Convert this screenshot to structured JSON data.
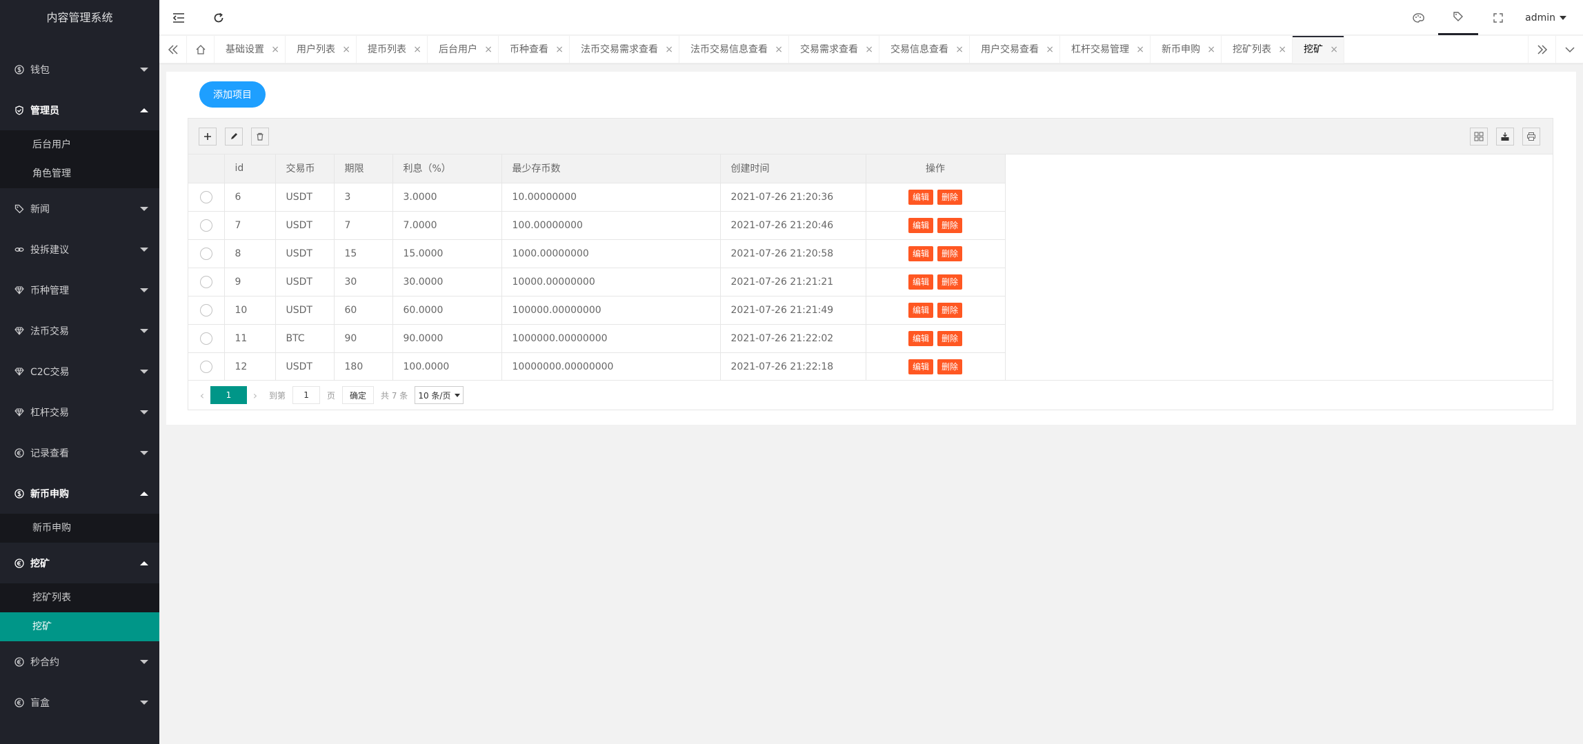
{
  "app": {
    "title": "内容管理系统"
  },
  "sidebar": {
    "groups": [
      {
        "label": "钱包",
        "icon": "dollar-icon",
        "open": false,
        "items": []
      },
      {
        "label": "管理员",
        "icon": "shield-icon",
        "open": true,
        "items": [
          {
            "label": "后台用户",
            "active": false
          },
          {
            "label": "角色管理",
            "active": false
          }
        ]
      },
      {
        "label": "新闻",
        "icon": "tag-icon",
        "open": false,
        "items": []
      },
      {
        "label": "投拆建议",
        "icon": "link-icon",
        "open": false,
        "items": []
      },
      {
        "label": "币种管理",
        "icon": "diamond-icon",
        "open": false,
        "items": []
      },
      {
        "label": "法币交易",
        "icon": "diamond-icon",
        "open": false,
        "items": []
      },
      {
        "label": "C2C交易",
        "icon": "diamond-icon",
        "open": false,
        "items": []
      },
      {
        "label": "杠杆交易",
        "icon": "diamond-icon",
        "open": false,
        "items": []
      },
      {
        "label": "记录查看",
        "icon": "euro-icon",
        "open": false,
        "items": []
      },
      {
        "label": "新币申购",
        "icon": "dollar-icon",
        "open": true,
        "items": [
          {
            "label": "新币申购",
            "active": false
          }
        ]
      },
      {
        "label": "挖矿",
        "icon": "euro-icon",
        "open": true,
        "items": [
          {
            "label": "挖矿列表",
            "active": false
          },
          {
            "label": "挖矿",
            "active": true
          }
        ]
      },
      {
        "label": "秒合约",
        "icon": "euro-icon",
        "open": false,
        "items": []
      },
      {
        "label": "盲盒",
        "icon": "euro-icon",
        "open": false,
        "items": []
      }
    ]
  },
  "header": {
    "user": "admin",
    "icons": [
      "collapse-menu-icon",
      "refresh-icon",
      "theme-icon",
      "tag-icon",
      "fullscreen-icon"
    ]
  },
  "tabs": [
    {
      "label": "基础设置",
      "active": false
    },
    {
      "label": "用户列表",
      "active": false
    },
    {
      "label": "提币列表",
      "active": false
    },
    {
      "label": "后台用户",
      "active": false
    },
    {
      "label": "币种查看",
      "active": false
    },
    {
      "label": "法币交易需求查看",
      "active": false
    },
    {
      "label": "法币交易信息查看",
      "active": false
    },
    {
      "label": "交易需求查看",
      "active": false
    },
    {
      "label": "交易信息查看",
      "active": false
    },
    {
      "label": "用户交易查看",
      "active": false
    },
    {
      "label": "杠杆交易管理",
      "active": false
    },
    {
      "label": "新币申购",
      "active": false
    },
    {
      "label": "挖矿列表",
      "active": false
    },
    {
      "label": "挖矿",
      "active": true
    }
  ],
  "content": {
    "add_button": "添加项目",
    "columns": [
      "id",
      "交易币",
      "期限",
      "利息（%）",
      "最少存币数",
      "创建时间",
      "操作"
    ],
    "rows": [
      {
        "id": "6",
        "coin": "USDT",
        "term": "3",
        "interest": "3.0000",
        "min": "10.00000000",
        "created": "2021-07-26 21:20:36"
      },
      {
        "id": "7",
        "coin": "USDT",
        "term": "7",
        "interest": "7.0000",
        "min": "100.00000000",
        "created": "2021-07-26 21:20:46"
      },
      {
        "id": "8",
        "coin": "USDT",
        "term": "15",
        "interest": "15.0000",
        "min": "1000.00000000",
        "created": "2021-07-26 21:20:58"
      },
      {
        "id": "9",
        "coin": "USDT",
        "term": "30",
        "interest": "30.0000",
        "min": "10000.00000000",
        "created": "2021-07-26 21:21:21"
      },
      {
        "id": "10",
        "coin": "USDT",
        "term": "60",
        "interest": "60.0000",
        "min": "100000.00000000",
        "created": "2021-07-26 21:21:49"
      },
      {
        "id": "11",
        "coin": "BTC",
        "term": "90",
        "interest": "90.0000",
        "min": "1000000.00000000",
        "created": "2021-07-26 21:22:02"
      },
      {
        "id": "12",
        "coin": "USDT",
        "term": "180",
        "interest": "100.0000",
        "min": "10000000.00000000",
        "created": "2021-07-26 21:22:18"
      }
    ],
    "row_actions": {
      "edit": "编辑",
      "delete": "删除"
    },
    "pager": {
      "current": "1",
      "goto_label": "到第",
      "goto_value": "1",
      "page_label": "页",
      "confirm": "确定",
      "total": "共 7 条",
      "page_size": "10 条/页"
    }
  },
  "colors": {
    "sidebar_bg": "#20222a",
    "accent": "#009688",
    "primary": "#1e9fff",
    "danger": "#ff5722"
  }
}
